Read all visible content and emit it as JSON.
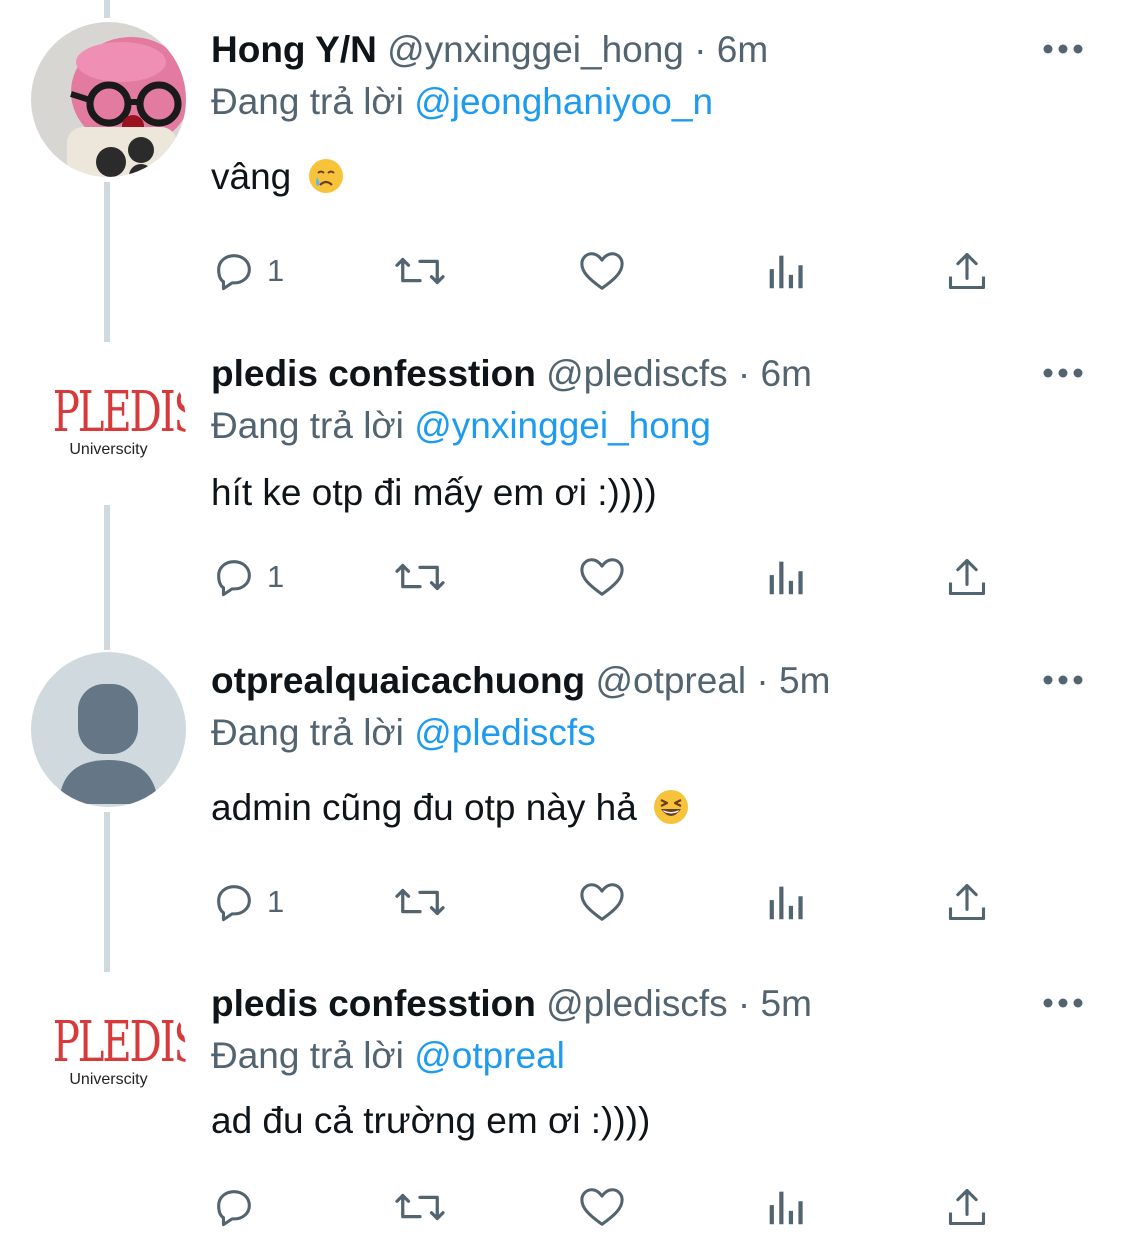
{
  "tweets": [
    {
      "display_name": "Hong Y/N",
      "handle": "@ynxinggei_hong",
      "separator": "·",
      "time": "6m",
      "reply_prefix": "Đang trả lời",
      "reply_to": "@jeonghaniyoo_n",
      "text": "vâng",
      "emoji": "crying-face",
      "reply_count": "1",
      "avatar": "pink-plush-with-glasses-photo"
    },
    {
      "display_name": "pledis confesstion",
      "handle": "@plediscfs",
      "separator": "·",
      "time": "6m",
      "reply_prefix": "Đang trả lời",
      "reply_to": "@ynxinggei_hong",
      "text": "hít ke otp đi mấy em ơi :))))",
      "reply_count": "1",
      "avatar": "pledis-logo"
    },
    {
      "display_name": "otprealquaicachuong",
      "handle": "@otpreal",
      "separator": "·",
      "time": "5m",
      "reply_prefix": "Đang trả lời",
      "reply_to": "@plediscfs",
      "text": "admin cũng đu otp này hả",
      "emoji": "grinning-squinting-face",
      "reply_count": "1",
      "avatar": "default-profile-silhouette"
    },
    {
      "display_name": "pledis confesstion",
      "handle": "@plediscfs",
      "separator": "·",
      "time": "5m",
      "reply_prefix": "Đang trả lời",
      "reply_to": "@otpreal",
      "text": "ad đu cả trường em ơi :))))",
      "reply_count": "",
      "avatar": "pledis-logo"
    }
  ],
  "logo": {
    "word": "PLEDIS",
    "sub": "Universcity"
  },
  "icons": [
    "reply-icon",
    "retweet-icon",
    "like-icon",
    "views-icon",
    "share-icon",
    "more-icon"
  ],
  "colors": {
    "text": "#0f1419",
    "muted": "#536471",
    "link": "#1d9bf0",
    "thread_line": "#cfd9de",
    "logo_red": "#d63a3a"
  }
}
